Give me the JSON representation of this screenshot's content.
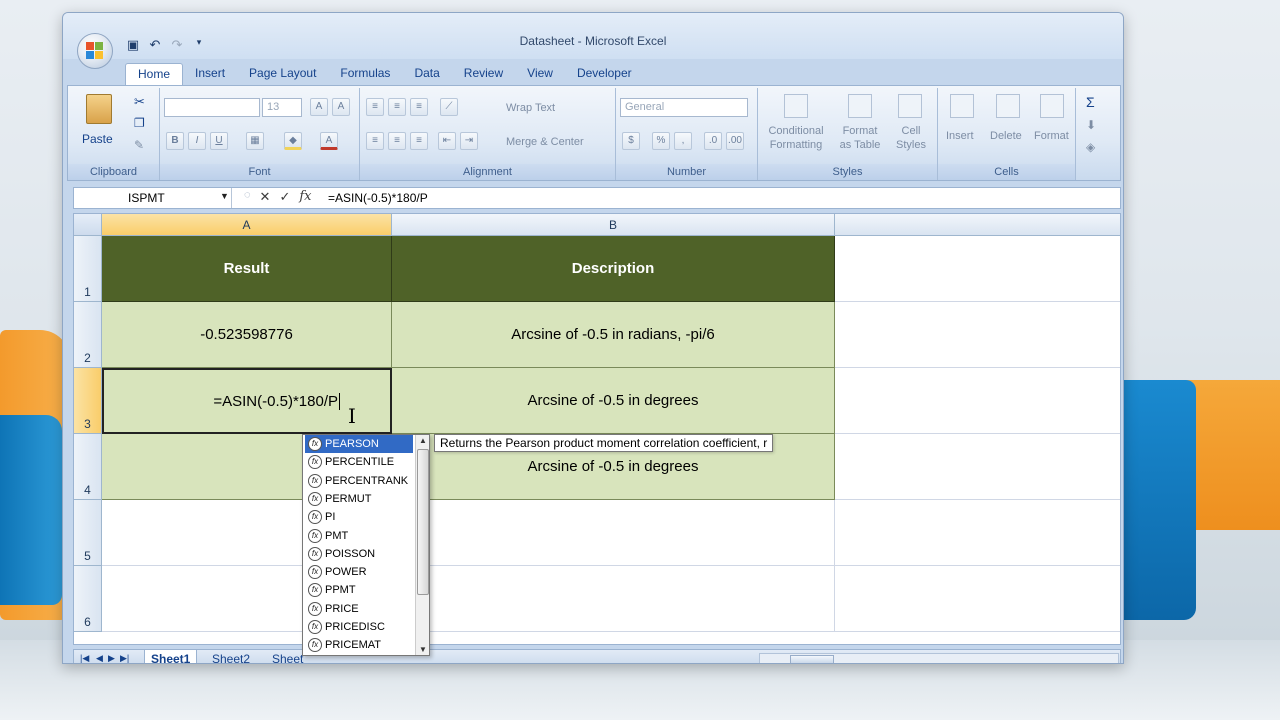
{
  "window": {
    "title": "Datasheet - Microsoft Excel"
  },
  "ribbon": {
    "tabs": [
      "Home",
      "Insert",
      "Page Layout",
      "Formulas",
      "Data",
      "Review",
      "View",
      "Developer"
    ],
    "clipboard": {
      "label": "Clipboard",
      "paste": "Paste"
    },
    "font": {
      "label": "Font",
      "size": "13",
      "bold": "B",
      "italic": "I",
      "underline": "U",
      "grow": "A",
      "shrink": "A"
    },
    "alignment": {
      "label": "Alignment",
      "wrap_text": "Wrap Text",
      "merge_center": "Merge & Center"
    },
    "number": {
      "label": "Number",
      "format": "General",
      "currency": "$",
      "percent": "%"
    },
    "styles": {
      "label": "Styles",
      "conditional_1": "Conditional",
      "conditional_2": "Formatting",
      "format_table_1": "Format",
      "format_table_2": "as Table",
      "cell_styles_1": "Cell",
      "cell_styles_2": "Styles"
    },
    "cells": {
      "label": "Cells",
      "insert": "Insert",
      "delete": "Delete",
      "format": "Format"
    },
    "editing": {
      "sum": "Σ"
    }
  },
  "formula_bar": {
    "name_box": "ISPMT",
    "cancel": "✕",
    "enter": "✓",
    "fx": "fx",
    "formula": "=ASIN(-0.5)*180/P"
  },
  "grid": {
    "columns": [
      "A",
      "B"
    ],
    "rows": [
      "1",
      "2",
      "3",
      "4",
      "5",
      "6"
    ],
    "cells": {
      "A1": "Result",
      "B1": "Description",
      "A2": "-0.523598776",
      "B2": "Arcsine of -0.5 in radians, -pi/6",
      "A3": "=ASIN(-0.5)*180/P",
      "B3": "Arcsine of -0.5 in degrees",
      "B4": "Arcsine of -0.5 in degrees"
    }
  },
  "autocomplete": {
    "items": [
      "PEARSON",
      "PERCENTILE",
      "PERCENTRANK",
      "PERMUT",
      "PI",
      "PMT",
      "POISSON",
      "POWER",
      "PPMT",
      "PRICE",
      "PRICEDISC",
      "PRICEMAT"
    ],
    "selected_index": 0,
    "tooltip": "Returns the Pearson product moment correlation coefficient, r"
  },
  "sheets": {
    "tabs": [
      "Sheet1",
      "Sheet2",
      "Sheet"
    ],
    "active": "Sheet1"
  },
  "colors": {
    "header_fill": "#4f6228",
    "body_fill": "#d8e4bc",
    "selection": "#316ac5"
  }
}
